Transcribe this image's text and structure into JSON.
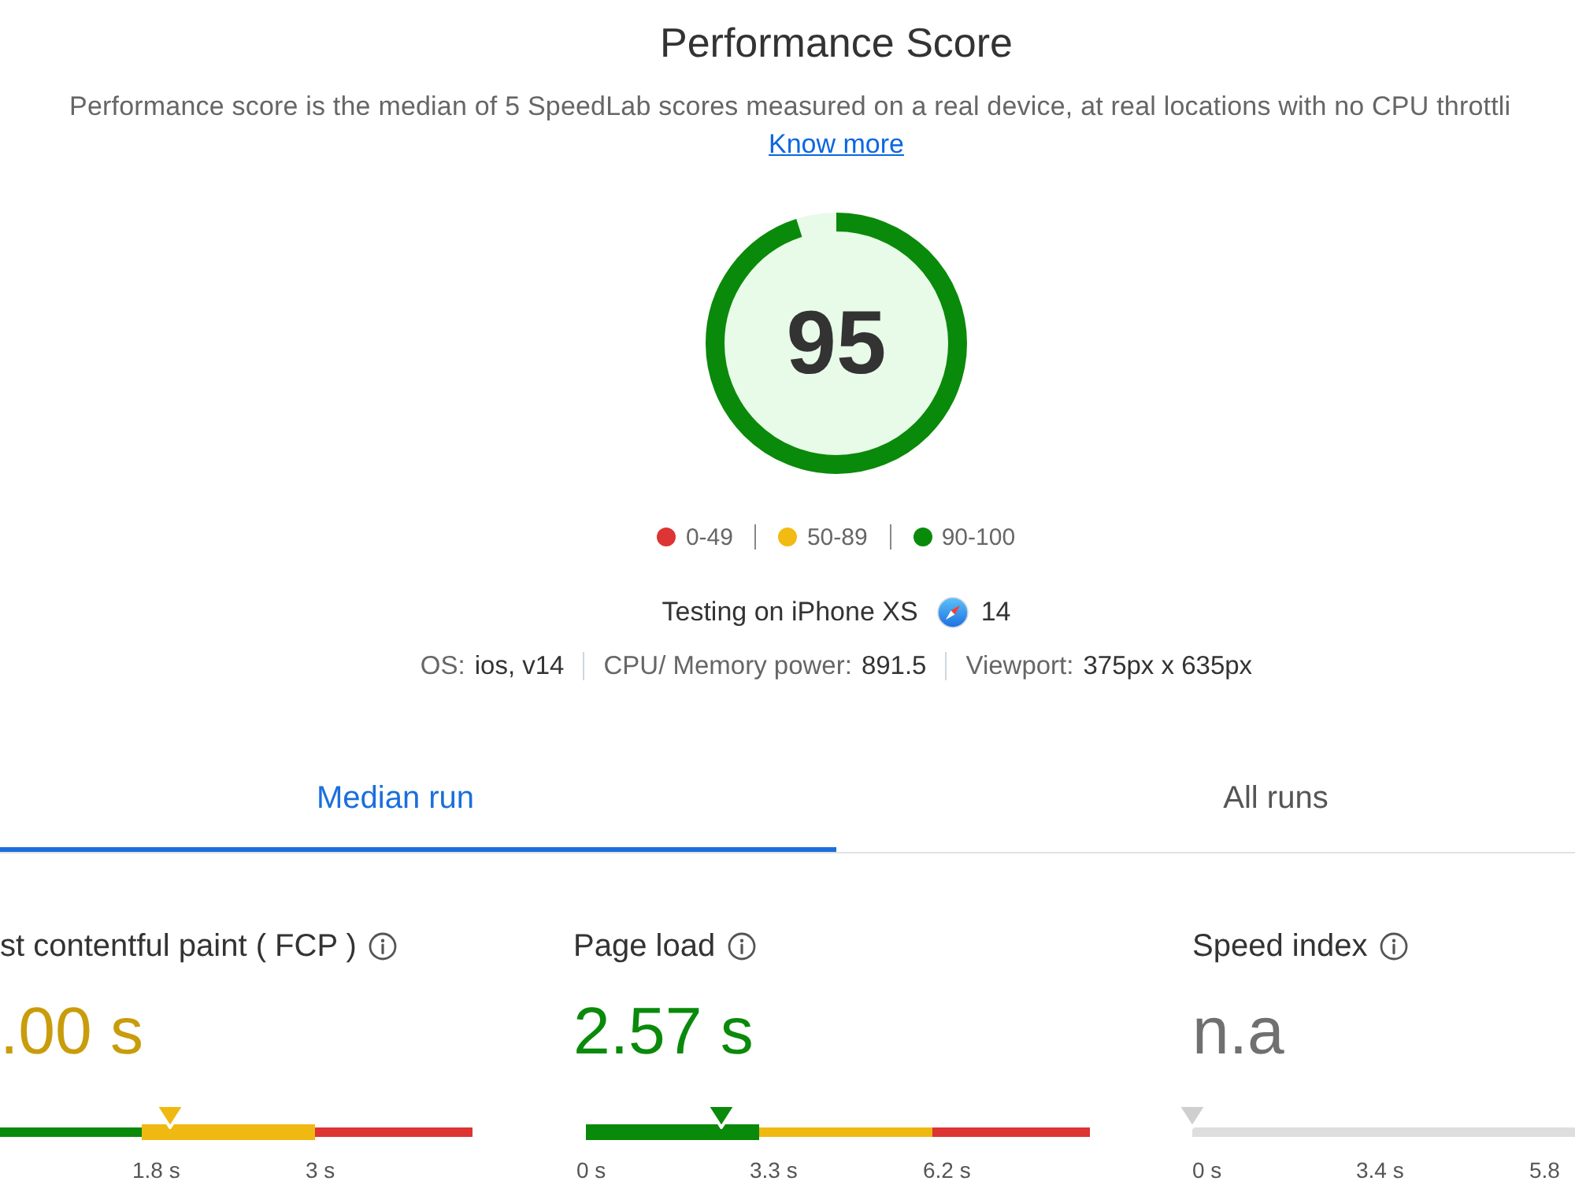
{
  "header": {
    "title": "Performance Score",
    "description": "Performance score is the median of 5 SpeedLab scores measured on a real device, at real locations with no CPU throttli",
    "link": "Know more"
  },
  "gauge": {
    "score": "95",
    "level": 0.95
  },
  "legend": [
    {
      "label": "0-49",
      "color": "#dd3434"
    },
    {
      "label": "50-89",
      "color": "#f2bb13"
    },
    {
      "label": "90-100",
      "color": "#0a8a0a"
    }
  ],
  "device": {
    "label": "Testing on iPhone XS",
    "browser_version": "14"
  },
  "specs": [
    {
      "label": "OS:",
      "value": "ios, v14"
    },
    {
      "label": "CPU/ Memory power:",
      "value": "891.5"
    },
    {
      "label": "Viewport:",
      "value": "375px x 635px"
    }
  ],
  "tabs": [
    {
      "label": "Median run",
      "selected": true
    },
    {
      "label": "All runs",
      "selected": false
    }
  ],
  "metrics": [
    {
      "title": "st contentful paint ( FCP )",
      "value": ".00 s",
      "color": "#c99c0c",
      "level": 0.36,
      "zones": [
        {
          "color": "#0a8a0a",
          "selected": false
        },
        {
          "label": "1.8 s",
          "color": "#f0b912",
          "selected": true
        },
        {
          "label": "3 s",
          "color": "#dd3434",
          "selected": false
        }
      ]
    },
    {
      "title": "Page load",
      "value": "2.57 s",
      "color": "#0a8a0a",
      "level": 0.27,
      "zones": [
        {
          "label": "0 s",
          "color": "#0a8a0a",
          "selected": true
        },
        {
          "label": "3.3 s",
          "color": "#f0b912",
          "selected": false
        },
        {
          "label": "6.2 s",
          "color": "#dd3434",
          "selected": false
        }
      ]
    },
    {
      "title": "Speed index",
      "value": "n.a",
      "color": "#707070",
      "level": 0,
      "zones": [
        {
          "label": "0 s"
        },
        {
          "label": "3.4 s"
        },
        {
          "label": "5.8"
        }
      ]
    }
  ]
}
